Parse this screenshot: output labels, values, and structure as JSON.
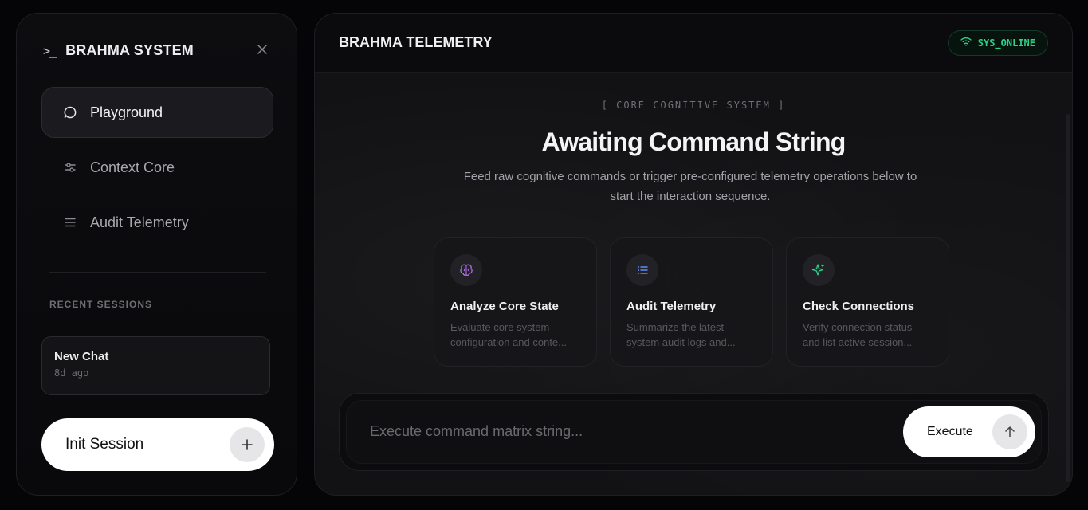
{
  "sidebar": {
    "prompt_glyph": ">_",
    "title": "BRAHMA SYSTEM",
    "nav": [
      {
        "label": "Playground",
        "icon": "chat-bubble-icon",
        "active": true
      },
      {
        "label": "Context Core",
        "icon": "sliders-icon",
        "active": false
      },
      {
        "label": "Audit Telemetry",
        "icon": "list-icon",
        "active": false
      }
    ],
    "recent_label": "RECENT SESSIONS",
    "sessions": [
      {
        "title": "New Chat",
        "time": "8d ago"
      }
    ],
    "init_label": "Init Session"
  },
  "header": {
    "title": "BRAHMA TELEMETRY",
    "status": "SYS_ONLINE",
    "status_color": "#2fd08a"
  },
  "hero": {
    "eyebrow": "[ CORE COGNITIVE SYSTEM ]",
    "headline": "Awaiting Command String",
    "sub_line1": "Feed raw cognitive commands or trigger pre-configured telemetry operations below to",
    "sub_line2": "start the interaction sequence."
  },
  "cards": [
    {
      "title": "Analyze Core State",
      "desc1": "Evaluate core system",
      "desc2": "configuration and conte...",
      "icon": "brain-icon",
      "icon_color": "#b06ee8"
    },
    {
      "title": "Audit Telemetry",
      "desc1": "Summarize the latest",
      "desc2": "system audit logs and...",
      "icon": "list-icon",
      "icon_color": "#5b8cff"
    },
    {
      "title": "Check Connections",
      "desc1": "Verify connection status",
      "desc2": "and list active session...",
      "icon": "sparkle-icon",
      "icon_color": "#2fd08a"
    }
  ],
  "composer": {
    "placeholder": "Execute command matrix string...",
    "value": "",
    "execute_label": "Execute"
  }
}
